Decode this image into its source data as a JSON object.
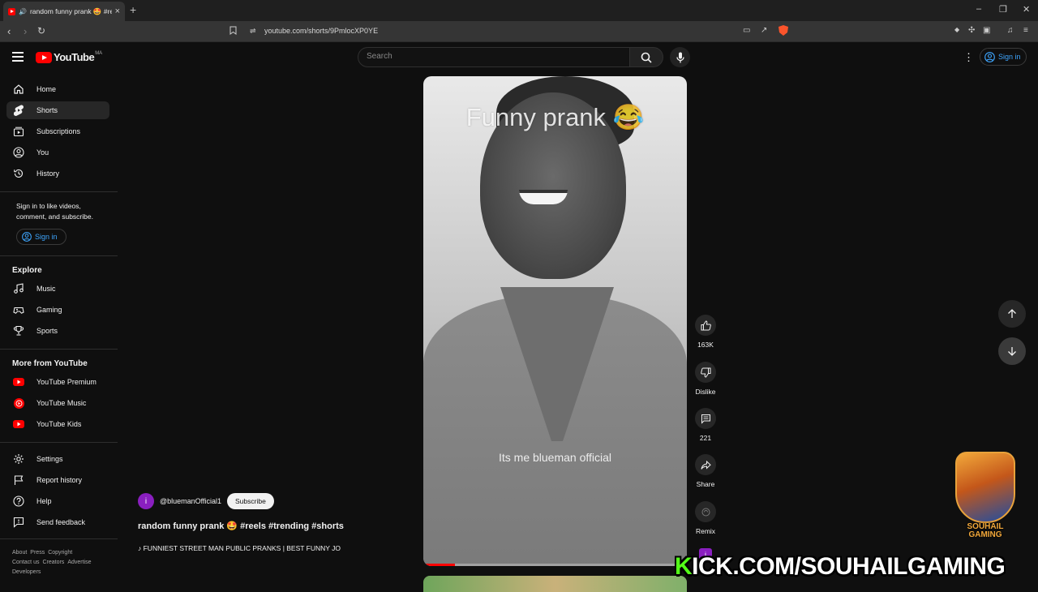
{
  "browser": {
    "tab_title": "random funny prank 🤩 #reels",
    "url": "youtube.com/shorts/9PmlocXP0YE",
    "icons": [
      "back-icon",
      "forward-icon",
      "reload-icon",
      "bookmark-icon",
      "site-info-icon",
      "cast-icon",
      "share-icon",
      "brave-shield-icon",
      "extensions-icon",
      "sidebar-icon",
      "media-icon",
      "menu-icon"
    ]
  },
  "header": {
    "logo_text": "YouTube",
    "country_code": "MA",
    "search_placeholder": "Search",
    "sign_in": "Sign in"
  },
  "sidebar": {
    "primary": [
      {
        "label": "Home",
        "icon": "home-icon"
      },
      {
        "label": "Shorts",
        "icon": "shorts-icon",
        "active": true
      },
      {
        "label": "Subscriptions",
        "icon": "subscriptions-icon"
      },
      {
        "label": "You",
        "icon": "you-icon"
      },
      {
        "label": "History",
        "icon": "history-icon"
      }
    ],
    "signin_message": "Sign in to like videos, comment, and subscribe.",
    "signin_button": "Sign in",
    "explore_heading": "Explore",
    "explore": [
      {
        "label": "Music",
        "icon": "music-icon"
      },
      {
        "label": "Gaming",
        "icon": "gaming-icon"
      },
      {
        "label": "Sports",
        "icon": "sports-icon"
      }
    ],
    "more_heading": "More from YouTube",
    "more": [
      {
        "label": "YouTube Premium",
        "icon": "youtube-premium-icon"
      },
      {
        "label": "YouTube Music",
        "icon": "youtube-music-icon"
      },
      {
        "label": "YouTube Kids",
        "icon": "youtube-kids-icon"
      }
    ],
    "settings": [
      {
        "label": "Settings",
        "icon": "gear-icon"
      },
      {
        "label": "Report history",
        "icon": "flag-icon"
      },
      {
        "label": "Help",
        "icon": "help-icon"
      },
      {
        "label": "Send feedback",
        "icon": "feedback-icon"
      }
    ],
    "footer_links": [
      "About",
      "Press",
      "Copyright",
      "Contact us",
      "Creators",
      "Advertise",
      "Developers"
    ]
  },
  "short": {
    "caption": "Funny prank 😂",
    "watermark": "Its me blueman official",
    "progress": 0.12,
    "channel_initial": "i",
    "channel": "@bluemanOfficial1",
    "subscribe": "Subscribe",
    "title": "random funny prank 🤩  #reels #trending #shorts",
    "sound": "♪ FUNNIEST STREET MAN PUBLIC PRANKS | BEST FUNNY JO"
  },
  "actions": {
    "like_count": "163K",
    "dislike": "Dislike",
    "comments_count": "221",
    "share": "Share",
    "remix": "Remix"
  },
  "overlay": {
    "badge_line1": "SOUHAIL",
    "badge_line2": "GAMING",
    "kick_k": "K",
    "kick_rest": "ICK.COM/SOUHAILGAMING"
  },
  "colors": {
    "background": "#0f0f0f",
    "youtube_red": "#ff0000",
    "link_blue": "#3ea6ff",
    "kick_green": "#53fc18"
  }
}
